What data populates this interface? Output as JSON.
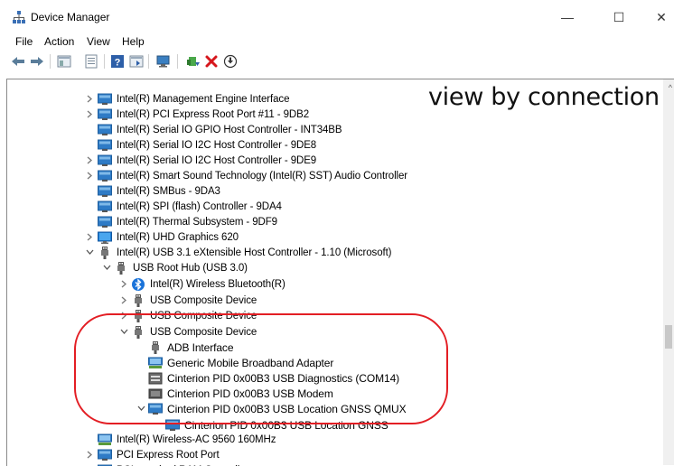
{
  "window": {
    "title": "Device Manager",
    "minimize": "—",
    "maximize": "☐",
    "close": "✕"
  },
  "menu": [
    "File",
    "Action",
    "View",
    "Help"
  ],
  "annotation": "view by connection",
  "tree": [
    {
      "label": "Intel(R) Management Engine Interface",
      "chev": "right",
      "icon": "monitor"
    },
    {
      "label": "Intel(R) PCI Express Root Port #11 - 9DB2",
      "chev": "right",
      "icon": "monitor"
    },
    {
      "label": "Intel(R) Serial IO GPIO Host Controller - INT34BB",
      "chev": "",
      "icon": "monitor"
    },
    {
      "label": "Intel(R) Serial IO I2C Host Controller - 9DE8",
      "chev": "",
      "icon": "monitor"
    },
    {
      "label": "Intel(R) Serial IO I2C Host Controller - 9DE9",
      "chev": "right",
      "icon": "monitor"
    },
    {
      "label": "Intel(R) Smart Sound Technology (Intel(R) SST) Audio Controller",
      "chev": "right",
      "icon": "monitor"
    },
    {
      "label": "Intel(R) SMBus - 9DA3",
      "chev": "",
      "icon": "monitor"
    },
    {
      "label": "Intel(R) SPI (flash) Controller - 9DA4",
      "chev": "",
      "icon": "monitor"
    },
    {
      "label": "Intel(R) Thermal Subsystem - 9DF9",
      "chev": "",
      "icon": "monitor"
    },
    {
      "label": "Intel(R) UHD Graphics 620",
      "chev": "right",
      "icon": "display"
    },
    {
      "label": "Intel(R) USB 3.1 eXtensible Host Controller - 1.10 (Microsoft)",
      "chev": "down",
      "icon": "usb"
    },
    {
      "label": "USB Root Hub (USB 3.0)",
      "chev": "down",
      "icon": "usb"
    },
    {
      "label": "Intel(R) Wireless Bluetooth(R)",
      "chev": "right",
      "icon": "bluetooth"
    },
    {
      "label": "USB Composite Device",
      "chev": "right",
      "icon": "usb"
    },
    {
      "label": "USB Composite Device",
      "chev": "right",
      "icon": "usb"
    },
    {
      "label": "USB Composite Device",
      "chev": "down",
      "icon": "usb"
    },
    {
      "label": "ADB Interface",
      "chev": "",
      "icon": "usb"
    },
    {
      "label": "Generic Mobile Broadband Adapter",
      "chev": "",
      "icon": "network"
    },
    {
      "label": "Cinterion PID 0x00B3 USB Diagnostics (COM14)",
      "chev": "",
      "icon": "port"
    },
    {
      "label": "Cinterion PID 0x00B3 USB Modem",
      "chev": "",
      "icon": "modem"
    },
    {
      "label": "Cinterion PID 0x00B3 USB Location GNSS QMUX",
      "chev": "down",
      "icon": "monitor"
    },
    {
      "label": "Cinterion PID 0x00B3 USB Location GNSS",
      "chev": "",
      "icon": "monitor"
    },
    {
      "label": "Intel(R) Wireless-AC 9560 160MHz",
      "chev": "",
      "icon": "network"
    },
    {
      "label": "PCI Express Root Port",
      "chev": "right",
      "icon": "monitor"
    },
    {
      "label": "PCI standard RAM Controller",
      "chev": "",
      "icon": "monitor"
    }
  ]
}
